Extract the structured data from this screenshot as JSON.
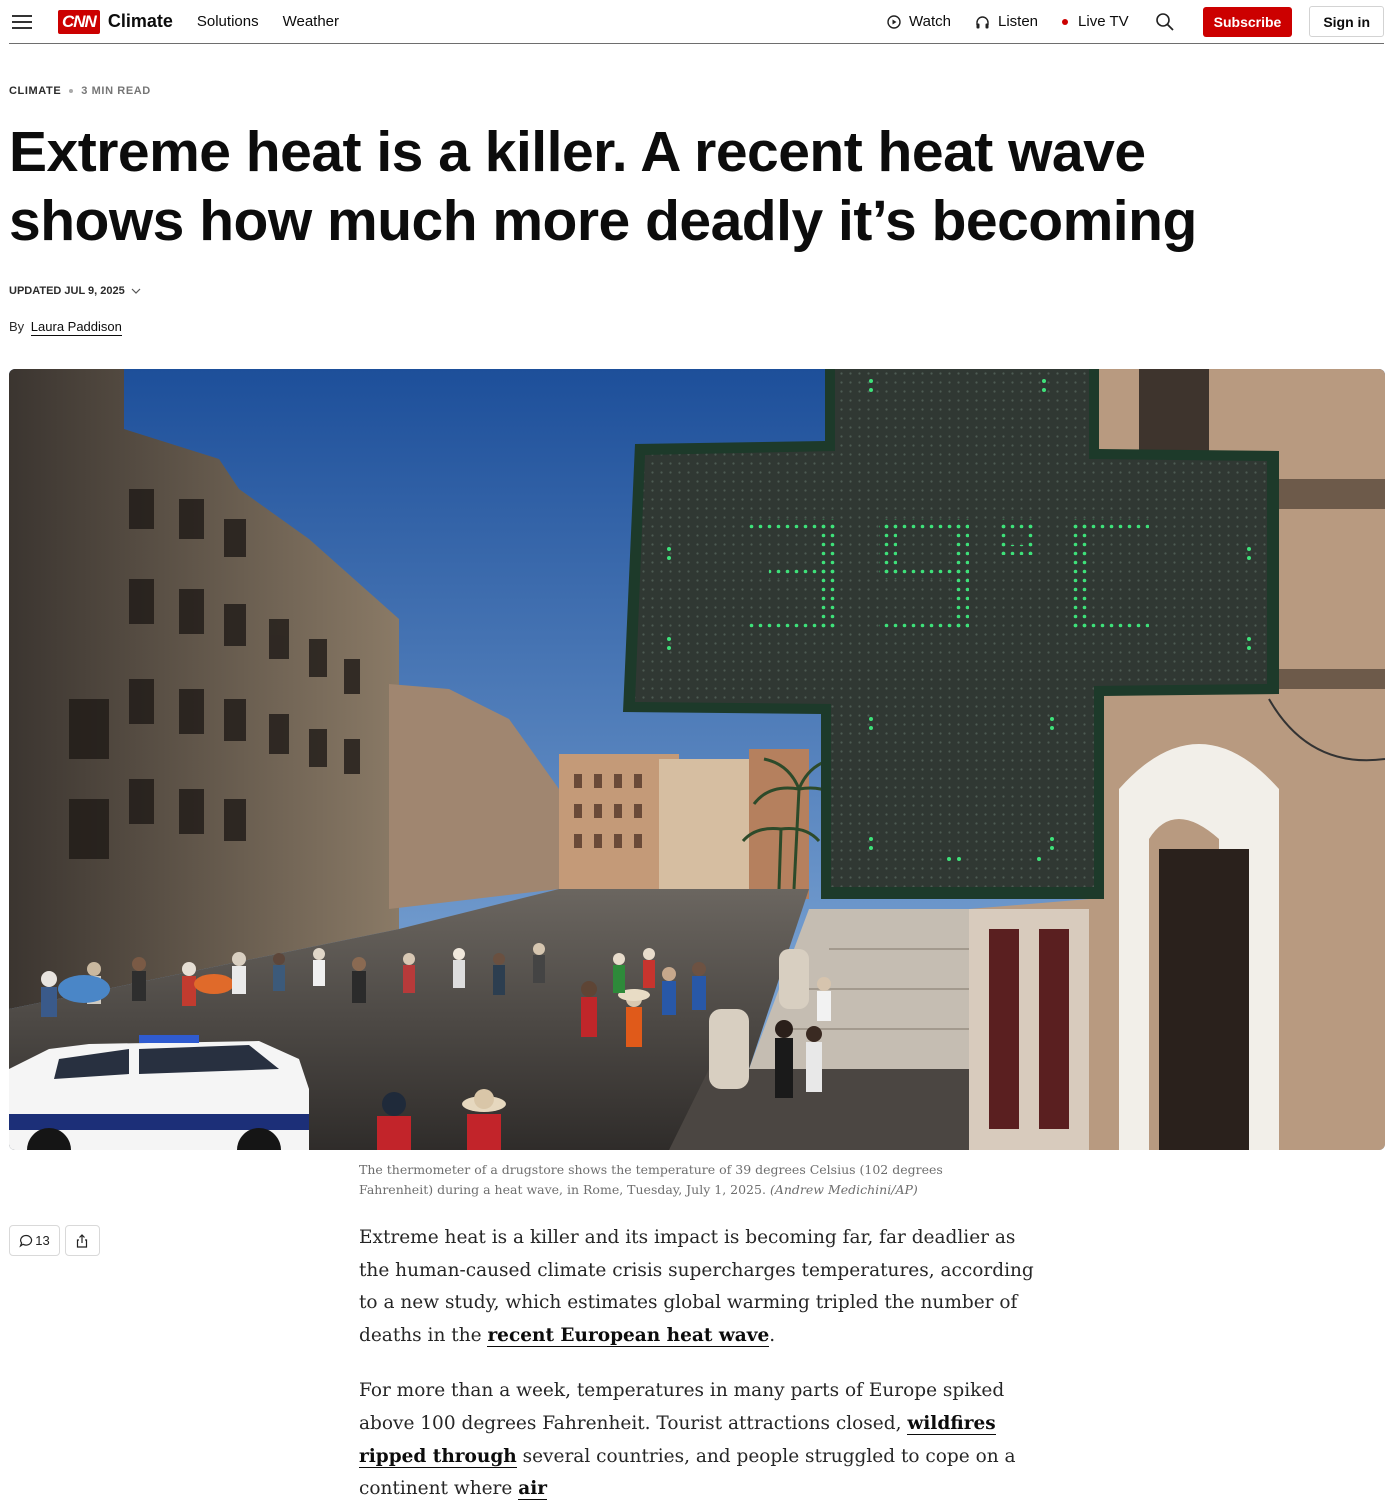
{
  "nav": {
    "logo": "CNN",
    "section": "Climate",
    "links": [
      "Solutions",
      "Weather"
    ],
    "watch": "Watch",
    "listen": "Listen",
    "live_tv": "Live TV",
    "subscribe": "Subscribe",
    "sign_in": "Sign in"
  },
  "article": {
    "kicker_section": "CLIMATE",
    "read_time": "3 MIN READ",
    "headline_line1": "Extreme heat is a killer. A recent heat wave",
    "headline_line2": "shows how much more deadly it’s becoming",
    "updated": "UPDATED JUL 9, 2025",
    "byline_prefix": "By",
    "author": "Laura Paddison",
    "image_caption": "The thermometer of a drugstore shows the temperature of 39 degrees Celsius (102 degrees Fahrenheit) during a heat wave, in Rome, Tuesday, July 1, 2025.",
    "image_credit": "(Andrew Medichini/AP)",
    "comment_count": "13",
    "p1_text": "Extreme heat is a killer and its impact is becoming far, far deadlier as the human-caused climate crisis supercharges temperatures, according to a new study, which estimates global warming tripled the number of deaths in the ",
    "p1_link": "recent European heat wave",
    "p1_end": ".",
    "p2_text": "For more than a week, temperatures in many parts of Europe spiked above 100 degrees Fahrenheit. Tourist attractions closed, ",
    "p2_link": "wildfires ripped through",
    "p2_mid": " several countries, and people struggled to cope on a continent where ",
    "p2_link2": "air"
  },
  "colors": {
    "brand_red": "#cc0000",
    "sign_green": "#3ee27a"
  },
  "icons": [
    "menu-icon",
    "play-circle-icon",
    "headphones-icon",
    "live-dot-icon",
    "search-icon",
    "comment-icon",
    "share-icon",
    "chevron-down-icon"
  ]
}
